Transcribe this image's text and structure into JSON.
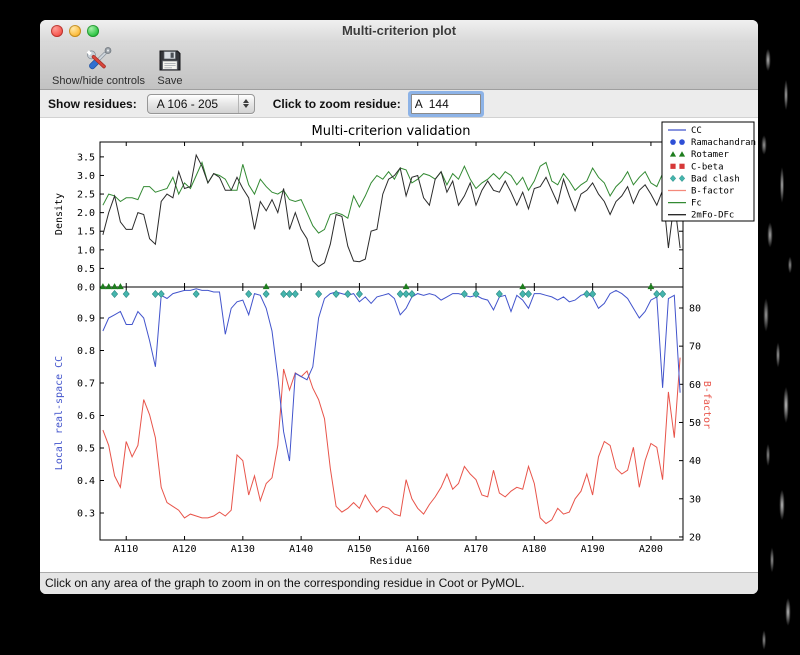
{
  "window": {
    "title": "Multi-criterion plot"
  },
  "toolbar": {
    "show_hide_label": "Show/hide controls",
    "save_label": "Save"
  },
  "controls": {
    "show_residues_label": "Show residues:",
    "residue_range_value": "A 106 - 205",
    "zoom_residue_label": "Click to zoom residue:",
    "zoom_residue_value": "A  144"
  },
  "status_bar": {
    "text": "Click on any area of the graph to zoom in on the corresponding residue in Coot or PyMOL."
  },
  "icons": {
    "show_hide": "crossed-tools-icon",
    "save": "floppy-disk-icon",
    "popup_stepper": "up-down-arrows-icon"
  },
  "colors": {
    "cc_blue": "#4254cc",
    "bfactor_red": "#e8544a",
    "bfactor_legend": "#f4897b",
    "fc_green": "#338a33",
    "map_black": "#2b2b2b",
    "rotamer_green": "#1e7d1e",
    "clash_teal": "#45b5ad",
    "rama_blue": "#2e4fd6",
    "cbeta_red": "#d63838"
  },
  "chart_data": {
    "type": "line",
    "title": "Multi-criterion validation",
    "xlabel": "Residue",
    "xlim": [
      105.5,
      205.5
    ],
    "x_start_residue": 106,
    "x_ticks": {
      "values": [
        110,
        120,
        130,
        140,
        150,
        160,
        170,
        180,
        190,
        200
      ],
      "labels": [
        "A110",
        "A120",
        "A130",
        "A140",
        "A150",
        "A160",
        "A170",
        "A180",
        "A190",
        "A200"
      ]
    },
    "subplots": [
      {
        "ylabel": "Density",
        "ylim": [
          0,
          3.9
        ],
        "yticks": {
          "values": [
            0,
            0.5,
            1.0,
            1.5,
            2.0,
            2.5,
            3.0,
            3.5
          ],
          "labels": [
            "0.0",
            "0.5",
            "1.0",
            "1.5",
            "2.0",
            "2.5",
            "3.0",
            "3.5"
          ]
        },
        "series": [
          {
            "name": "Fc",
            "color": "#338a33",
            "values": [
              2.2,
              2.5,
              2.45,
              2.3,
              2.4,
              2.4,
              2.35,
              2.7,
              2.7,
              2.55,
              2.6,
              2.65,
              2.95,
              2.5,
              2.8,
              2.65,
              3.0,
              3.35,
              2.8,
              3.05,
              3.0,
              2.9,
              2.6,
              2.6,
              3.3,
              2.75,
              2.5,
              2.9,
              2.7,
              2.55,
              2.5,
              2.6,
              2.35,
              2.3,
              2.35,
              2.0,
              1.65,
              1.45,
              1.55,
              1.95,
              2.0,
              1.95,
              1.85,
              2.45,
              2.15,
              2.45,
              2.8,
              3.0,
              2.9,
              3.1,
              2.9,
              3.2,
              3.15,
              2.8,
              2.9,
              3.05,
              3.0,
              2.9,
              3.1,
              2.75,
              3.05,
              2.9,
              3.25,
              2.9,
              2.65,
              2.8,
              2.9,
              3.05,
              2.9,
              3.1,
              3.0,
              2.75,
              2.95,
              2.6,
              2.85,
              3.25,
              3.35,
              2.85,
              2.75,
              3.05,
              2.85,
              2.6,
              2.75,
              2.85,
              3.2,
              2.95,
              2.8,
              2.45,
              2.7,
              2.85,
              3.1,
              2.75,
              2.95,
              3.1,
              2.8,
              2.7,
              3.05,
              2.5,
              2.85,
              2.6
            ]
          },
          {
            "name": "2mFo-DFc",
            "color": "#2b2b2b",
            "values": [
              1.4,
              2.0,
              2.45,
              1.75,
              1.55,
              1.55,
              2.0,
              1.95,
              1.3,
              1.15,
              2.3,
              2.5,
              2.4,
              3.1,
              2.65,
              2.7,
              3.55,
              3.25,
              2.8,
              3.05,
              2.95,
              2.6,
              2.6,
              2.95,
              2.65,
              2.4,
              1.55,
              2.3,
              2.05,
              2.35,
              2.0,
              2.65,
              1.55,
              2.0,
              1.55,
              1.3,
              0.7,
              0.55,
              0.65,
              1.15,
              1.95,
              1.9,
              1.1,
              0.7,
              0.68,
              0.75,
              1.5,
              1.55,
              2.5,
              2.9,
              3.0,
              3.2,
              2.45,
              2.95,
              3.0,
              2.4,
              2.2,
              2.9,
              3.1,
              2.55,
              2.85,
              2.2,
              2.45,
              2.8,
              2.2,
              2.6,
              2.85,
              2.6,
              2.55,
              2.85,
              2.55,
              2.2,
              2.55,
              2.1,
              2.65,
              2.7,
              2.95,
              2.6,
              2.25,
              2.9,
              2.45,
              2.05,
              2.5,
              2.6,
              2.8,
              2.5,
              2.3,
              1.95,
              2.3,
              2.45,
              2.7,
              2.25,
              2.6,
              2.75,
              2.5,
              2.2,
              2.6,
              1.05,
              2.3,
              1.05
            ]
          }
        ]
      },
      {
        "ylabel_left": "Local real-space CC",
        "ylim_left": [
          0.2169,
          0.9954
        ],
        "yticks_left": {
          "values": [
            0.3,
            0.4,
            0.5,
            0.6,
            0.7,
            0.8,
            0.9
          ],
          "labels": [
            "0.3",
            "0.4",
            "0.5",
            "0.6",
            "0.7",
            "0.8",
            "0.9"
          ]
        },
        "ylabel_right": "B-factor",
        "ylim_right": [
          19.2,
          85.5
        ],
        "yticks_right": {
          "values": [
            20,
            30,
            40,
            50,
            60,
            70,
            80
          ],
          "labels": [
            "20",
            "30",
            "40",
            "50",
            "60",
            "70",
            "80"
          ]
        },
        "series": [
          {
            "name": "CC",
            "axis": "left",
            "color": "#4254cc",
            "values": [
              0.86,
              0.9,
              0.91,
              0.92,
              0.88,
              0.88,
              0.92,
              0.9,
              0.83,
              0.75,
              0.97,
              0.96,
              0.975,
              0.98,
              0.985,
              0.985,
              0.99,
              0.985,
              0.985,
              0.98,
              0.98,
              0.85,
              0.93,
              0.95,
              0.955,
              0.91,
              0.975,
              0.97,
              0.93,
              0.86,
              0.72,
              0.55,
              0.46,
              0.73,
              0.72,
              0.71,
              0.75,
              0.9,
              0.96,
              0.975,
              0.98,
              0.975,
              0.97,
              0.975,
              0.95,
              0.965,
              0.945,
              0.965,
              0.97,
              0.975,
              0.96,
              0.91,
              0.93,
              0.965,
              0.975,
              0.97,
              0.975,
              0.97,
              0.955,
              0.965,
              0.975,
              0.975,
              0.97,
              0.965,
              0.97,
              0.96,
              0.955,
              0.925,
              0.965,
              0.97,
              0.92,
              0.97,
              0.955,
              0.93,
              0.975,
              0.975,
              0.97,
              0.965,
              0.955,
              0.965,
              0.95,
              0.955,
              0.97,
              0.975,
              0.965,
              0.93,
              0.945,
              0.975,
              0.985,
              0.975,
              0.96,
              0.93,
              0.9,
              0.92,
              0.955,
              0.965,
              0.685,
              0.96,
              0.97,
              0.67
            ]
          },
          {
            "name": "B-factor",
            "axis": "right",
            "color": "#e8544a",
            "values": [
              48,
              44,
              36,
              33,
              45,
              41,
              44,
              56,
              52,
              46,
              33,
              29,
              28,
              27,
              25,
              26,
              25.5,
              25,
              25,
              25.5,
              26.5,
              25.5,
              27,
              41.5,
              40,
              31,
              36,
              29.5,
              34,
              35.5,
              44,
              64,
              58.5,
              63,
              62,
              63.5,
              59,
              56,
              51,
              38,
              28,
              26.5,
              27.5,
              29,
              27.5,
              31,
              28.5,
              26.5,
              28,
              27.5,
              26,
              25.5,
              35,
              30,
              27.5,
              26,
              28.5,
              30.5,
              33,
              36.5,
              32.5,
              34,
              38.5,
              36.5,
              35,
              31,
              30.5,
              37.5,
              31.5,
              30.5,
              32,
              33,
              32.5,
              38.5,
              34,
              25,
              23.5,
              24.5,
              27.5,
              26,
              26.5,
              30,
              32,
              36.5,
              31,
              41,
              45,
              44,
              38,
              36.5,
              37.5,
              43.5,
              33,
              40,
              44.5,
              43.5,
              35,
              58,
              46,
              67
            ]
          }
        ],
        "markers": [
          {
            "name": "Rotamer",
            "shape": "triangle",
            "color": "#1e7d1e",
            "residues": [
              106,
              107,
              108,
              109,
              134,
              158,
              178,
              200
            ]
          },
          {
            "name": "Bad clash",
            "shape": "diamond",
            "color": "#45b5ad",
            "residues": [
              108,
              110,
              115,
              116,
              122,
              131,
              134,
              137,
              138,
              139,
              143,
              146,
              148,
              150,
              157,
              158,
              159,
              168,
              170,
              174,
              178,
              179,
              189,
              190,
              201,
              202
            ]
          }
        ]
      }
    ],
    "legend": {
      "position": "upper right",
      "entries": [
        {
          "label": "CC",
          "type": "line",
          "color": "#4254cc"
        },
        {
          "label": "Ramachandran",
          "type": "circle",
          "color": "#2e4fd6"
        },
        {
          "label": "Rotamer",
          "type": "triangle",
          "color": "#1e7d1e"
        },
        {
          "label": "C-beta",
          "type": "square",
          "color": "#d63838"
        },
        {
          "label": "Bad clash",
          "type": "diamond",
          "color": "#45b5ad"
        },
        {
          "label": "B-factor",
          "type": "line",
          "color": "#f4897b"
        },
        {
          "label": "Fc",
          "type": "line",
          "color": "#338a33"
        },
        {
          "label": "2mFo-DFc",
          "type": "line",
          "color": "#2b2b2b"
        }
      ]
    }
  }
}
